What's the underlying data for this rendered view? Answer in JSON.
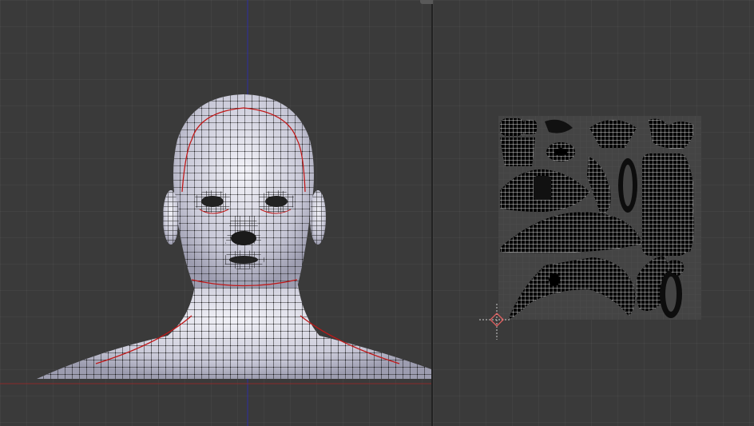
{
  "editor": {
    "left_view": "3d-viewport",
    "right_view": "uv-image-editor"
  },
  "colors": {
    "background": "#3a3a3a",
    "grid": "#444444",
    "axis_x": "#8a2a2a",
    "axis_z": "#2f2fa0",
    "mesh_surface": "#d9d9e6",
    "mesh_wire": "#000000",
    "seams": "#c01818",
    "uv_bounds": "#555555"
  },
  "icons": {
    "cursor": "3d-cursor-icon",
    "area_grip": "area-split-grip-icon"
  }
}
